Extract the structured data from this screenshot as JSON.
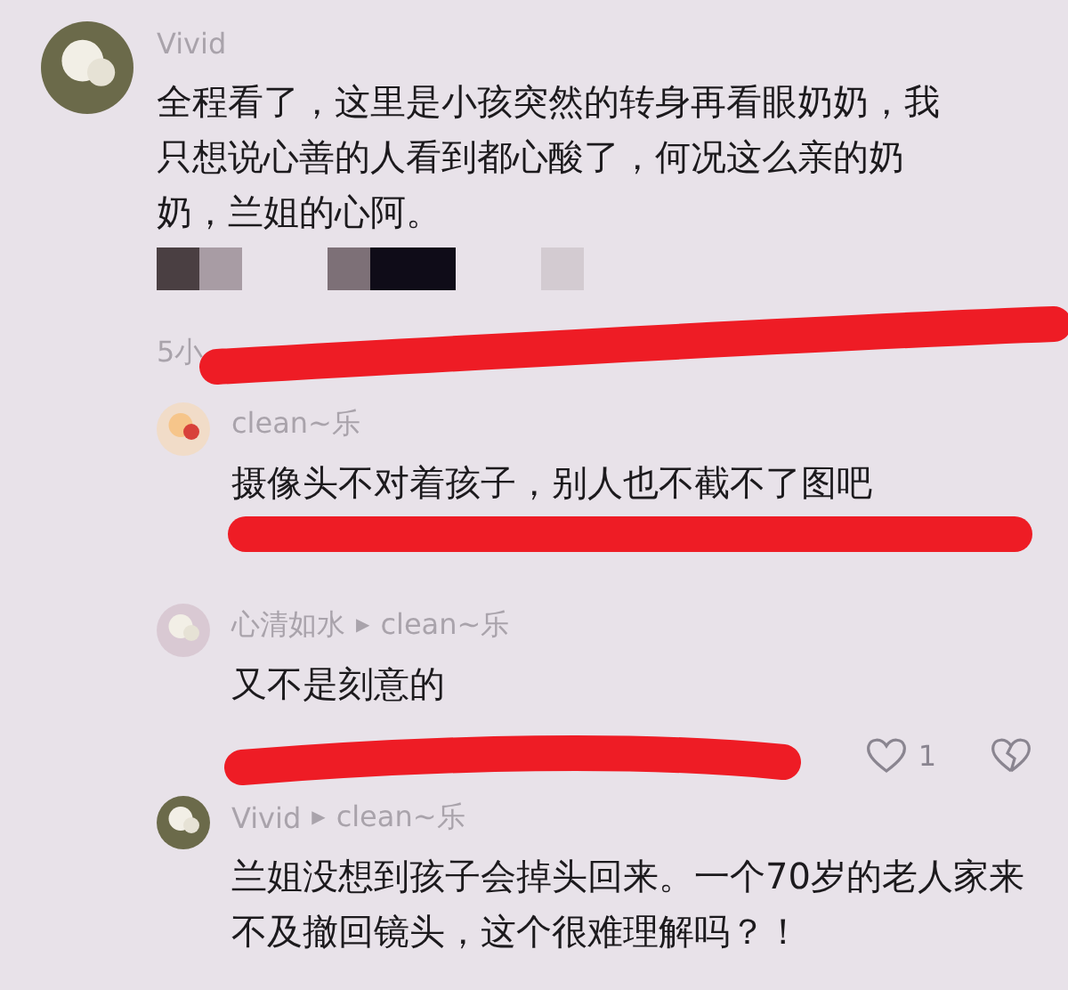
{
  "comments": [
    {
      "kind": "top",
      "author": "Vivid",
      "text": "全程看了，这里是小孩突然的转身再看眼奶奶，我只想说心善的人看到都心酸了，何况这么亲的奶奶，兰姐的心阿。",
      "meta": "5小",
      "redacted": true
    },
    {
      "kind": "reply",
      "author": "clean~乐",
      "text": "摄像头不对着孩子，别人也不截不了图吧"
    },
    {
      "kind": "reply",
      "author": "心清如水",
      "reply_arrow": "▶",
      "reply_to": "clean~乐",
      "text": "又不是刻意的",
      "likes": "1"
    },
    {
      "kind": "reply",
      "author": "Vivid",
      "reply_arrow": "▶",
      "reply_to": "clean~乐",
      "text": "兰姐没想到孩子会掉头回来。一个70岁的老人家来不及撤回镜头，这个很难理解吗？！"
    }
  ]
}
